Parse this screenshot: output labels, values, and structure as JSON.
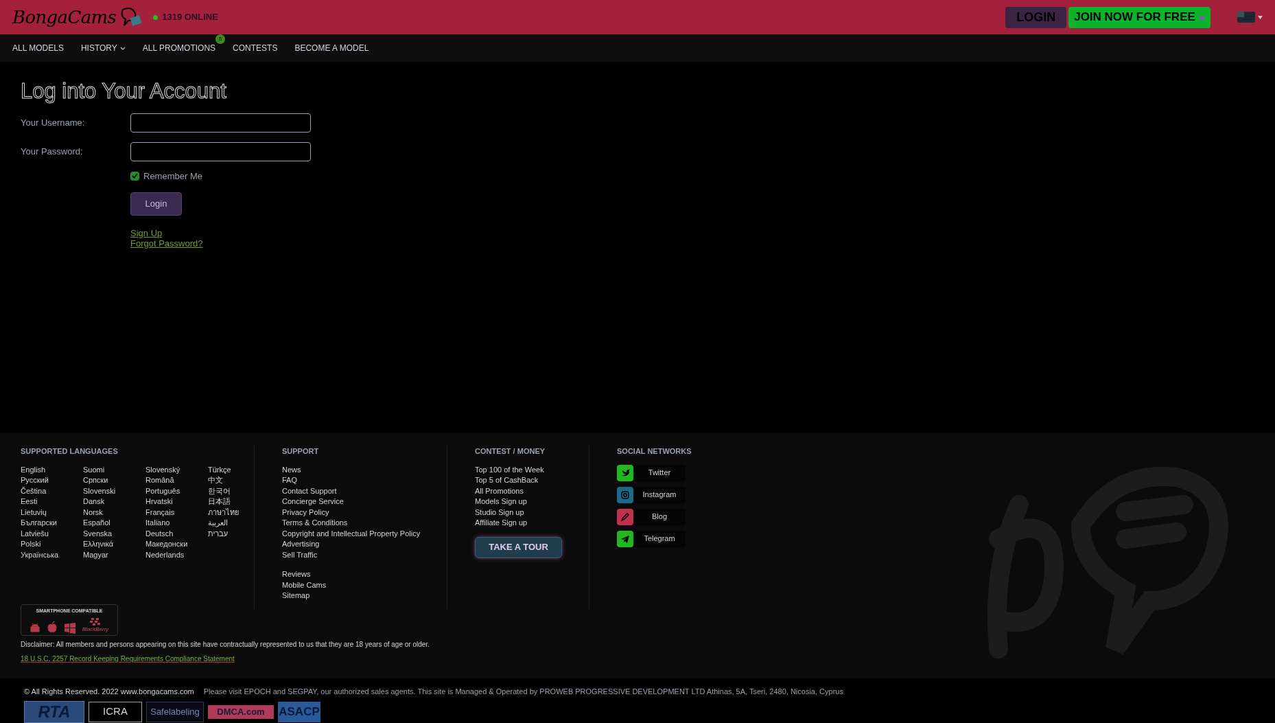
{
  "header": {
    "logo_text": "BongaCams",
    "online_count": "1319 ONLINE",
    "login_button": "LOGIN",
    "join_button": "JOIN NOW FOR FREE",
    "join_arrow": "»"
  },
  "nav": [
    {
      "label": "ALL MODELS",
      "kind": "plain"
    },
    {
      "label": "HISTORY",
      "kind": "dropdown"
    },
    {
      "label": "ALL PROMOTIONS",
      "kind": "badge",
      "badge": "5"
    },
    {
      "label": "CONTESTS",
      "kind": "plain"
    },
    {
      "label": "BECOME A MODEL",
      "kind": "plain"
    }
  ],
  "login": {
    "title": "Log into Your Account",
    "username_label": "Your Username:",
    "password_label": "Your Password:",
    "remember": {
      "label": "Remember Me",
      "checked": true
    },
    "submit": "Login",
    "links": [
      "Sign Up",
      "Forgot Password?"
    ]
  },
  "footer": {
    "languages": {
      "heading": "SUPPORTED LANGUAGES",
      "columns": [
        [
          "English",
          "Русский",
          "Čeština",
          "Eesti",
          "Lietuvių",
          "Български",
          "Latviešu",
          "Polski",
          "Українська"
        ],
        [
          "Suomi",
          "Српски",
          "Slovenski",
          "Dansk",
          "Norsk",
          "Español",
          "Svenska",
          "Ελληνικά",
          "Magyar"
        ],
        [
          "Slovenský",
          "Română",
          "Português",
          "Hrvatski",
          "Français",
          "Italiano",
          "Deutsch",
          "Македонски",
          "Nederlands"
        ],
        [
          "Türkçe",
          "中文",
          "한국어",
          "日本語",
          "ภาษาไทย",
          "العربية",
          "עברית"
        ]
      ]
    },
    "support": {
      "heading": "SUPPORT",
      "groups": [
        [
          "News",
          "FAQ",
          "Contact Support",
          "Concierge Service",
          "Privacy Policy",
          "Terms & Conditions",
          "Copyright and Intellectual Property Policy",
          "Advertising",
          "Sell Traffic"
        ],
        [
          "Reviews",
          "Mobile Cams",
          "Sitemap"
        ]
      ]
    },
    "contest": {
      "heading": "CONTEST / MONEY",
      "links": [
        "Top 100 of the Week",
        "Top 5 of CashBack",
        "All Promotions",
        "Models Sign up",
        "Studio Sign up",
        "Affiliate Sign up"
      ],
      "tour_button": "TAKE A TOUR"
    },
    "social": {
      "heading": "SOCIAL NETWORKS",
      "items": [
        {
          "label": "Twitter",
          "kind": "twitter",
          "color": "#1fb81f"
        },
        {
          "label": "Instagram",
          "kind": "instagram",
          "color": "#1b6a8a"
        },
        {
          "label": "Blog",
          "kind": "blog",
          "color": "#c0304f"
        },
        {
          "label": "Telegram",
          "kind": "telegram",
          "color": "#1fb81f"
        }
      ]
    },
    "smartphone": {
      "title": "SMARTPHONE COMPATIBLE",
      "blackberry": "BlackBerry"
    },
    "disclaimer": "Disclaimer: All members and persons appearing on this site have contractually represented to us that they are 18 years of age or older.",
    "compliance_link": "18 U.S.C. 2257 Record Keeping Requirements Compliance Statement",
    "copyright": "© All Rights Reserved. 2022 www.bongacams.com",
    "operator": "Please visit EPOCH and SEGPAY, our authorized sales agents. This site is Managed & Operated by PROWEB PROGRESSIVE DEVELOPMENT LTD Athinas, 5A, Tseri, 2480, Nicosia, Cyprus",
    "badges": [
      {
        "kind": "rta",
        "text": "RTA"
      },
      {
        "kind": "icra",
        "text": "ICRA"
      },
      {
        "kind": "safelabeling",
        "text": "Safelabeling"
      },
      {
        "kind": "dmca",
        "text": "DMCA.com"
      },
      {
        "kind": "asacp",
        "text": "ASACP"
      }
    ]
  }
}
